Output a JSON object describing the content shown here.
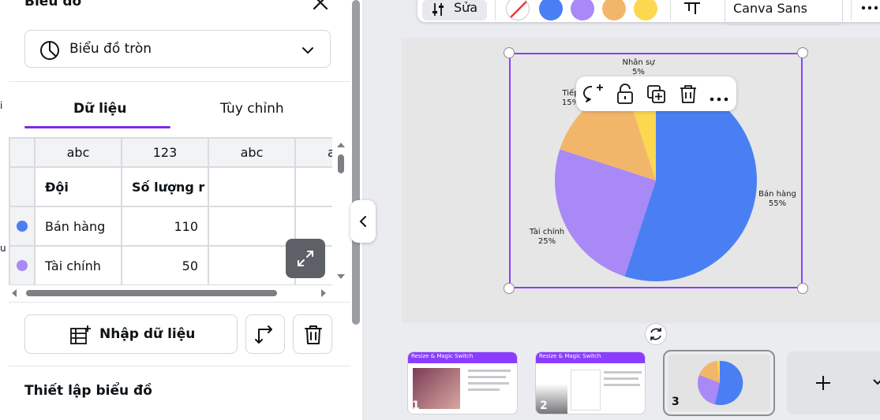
{
  "panel": {
    "title": "Biểu đồ",
    "chart_type": "Biểu đồ tròn",
    "tabs": [
      {
        "label": "Dữ liệu",
        "active": true
      },
      {
        "label": "Tùy chỉnh",
        "active": false
      }
    ],
    "grid": {
      "type_row": [
        "abc",
        "123",
        "abc",
        "a"
      ],
      "header_row": [
        "Đội",
        "Số lượng r",
        "",
        ""
      ],
      "rows": [
        {
          "color": "#4a7ff3",
          "label": "Bán hàng",
          "value": "110"
        },
        {
          "color": "#a989f5",
          "label": "Tài chính",
          "value": "50"
        }
      ]
    },
    "import_label": "Nhập dữ liệu",
    "setup_title": "Thiết lập biểu đồ"
  },
  "side_labels": [
    "i",
    "u"
  ],
  "toolbar": {
    "edit_label": "Sửa",
    "font_name": "Canva Sans",
    "swatches": [
      "#4a7ff3",
      "#a989f5",
      "#f2b66b",
      "#fbd84f"
    ]
  },
  "chart_data": {
    "type": "pie",
    "slices": [
      {
        "label": "Bán hàng",
        "percent": 55,
        "pct_label": "55%",
        "color": "#4a7ff3"
      },
      {
        "label": "Tài chính",
        "percent": 25,
        "pct_label": "25%",
        "color": "#a989f5"
      },
      {
        "label": "Tiếp",
        "percent": 15,
        "pct_label": "15%",
        "color": "#f2b66b"
      },
      {
        "label": "Nhân sự",
        "percent": 5,
        "pct_label": "5%",
        "color": "#fbd84f"
      }
    ]
  },
  "pages": [
    {
      "number": "1",
      "title": "Resize & Magic Switch"
    },
    {
      "number": "2",
      "title": "Resize & Magic Switch"
    },
    {
      "number": "3",
      "title": ""
    }
  ]
}
